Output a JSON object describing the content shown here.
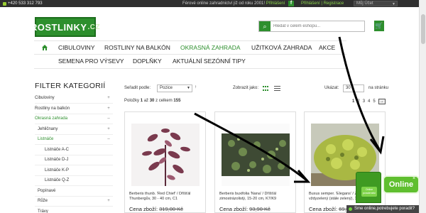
{
  "topbar": {
    "phone": "+420 533 312 793",
    "message": "Férové online zahradnictví již od roku 2001!",
    "message_link": "Přihlášení",
    "register": "Přihlášení | Registrace",
    "account": "Můj Účet"
  },
  "header": {
    "logo_name": "ROSTLINKY",
    "logo_tld": ".CZ",
    "search_placeholder": "Hledat v celém eshopu..."
  },
  "nav": {
    "row1": [
      "CIBULOVINY",
      "ROSTLINY NA BALKÓN",
      "OKRASNÁ ZAHRADA",
      "UŽITKOVÁ ZAHRADA",
      "AKCE"
    ],
    "row2": [
      "SEMENA PRO VÝSEVY",
      "DOPLŇKY",
      "AKTUÁLNÍ SEZÓNNÍ TIPY"
    ],
    "active": "OKRASNÁ ZAHRADA"
  },
  "filter": {
    "title": "FILTER KATEGORIÍ",
    "items": [
      {
        "label": "Cibuloviny",
        "toggle": "+"
      },
      {
        "label": "Rostliny na balkón",
        "toggle": "+"
      },
      {
        "label": "Okrasná zahrada",
        "toggle": "–"
      },
      {
        "label": "Jehličnany",
        "toggle": "+"
      },
      {
        "label": "Listnáče",
        "toggle": "–"
      },
      {
        "label": "Listnáče A-C",
        "toggle": ""
      },
      {
        "label": "Listnáče D-J",
        "toggle": ""
      },
      {
        "label": "Listnáče K-P",
        "toggle": ""
      },
      {
        "label": "Listnáče Q-Z",
        "toggle": ""
      },
      {
        "label": "Popínavé",
        "toggle": ""
      },
      {
        "label": "Růže",
        "toggle": "+"
      },
      {
        "label": "Trávy",
        "toggle": ""
      }
    ]
  },
  "toolbar": {
    "sort_label": "Seřadit podle:",
    "sort_value": "Pozice",
    "sort_dir": "↑",
    "view_label": "Zobrazit jako:",
    "show_label": "Ukázat:",
    "show_value": "30",
    "per_page": "na stránku"
  },
  "listing": {
    "counts_prefix": "Položky",
    "from": "1",
    "to_word": "až",
    "to": "30",
    "of_word": "z celkem",
    "total": "155",
    "pages": [
      "1",
      "2",
      "3",
      "4",
      "5"
    ],
    "next": "→"
  },
  "products": [
    {
      "name": "Berberis thunb. 'Red Chief' / Dříšťál Thunbergův, 30 - 40 cm, C1",
      "price_label": "Cena zboží:",
      "price": "319,00 Kč"
    },
    {
      "name": "Berberis buxifolia 'Nana' / Dříšťál zimostrázolistý, 15-20 cm, K7/K9",
      "price_label": "Cena zboží:",
      "price": "93,90 Kč"
    },
    {
      "name": "Buxus semper. 'Elegans' / Zimostráz vždyzelený (stále zelený), 10-20 cm, K7",
      "price_label": "Cena zboží:",
      "price": "69,90 Kč"
    }
  ],
  "chat": {
    "online": "Online",
    "close": "×",
    "bar": "Sme online,potrebujete poradit?",
    "badge": "Online poradenství"
  },
  "colors": {
    "brand_green": "#2d8f2d",
    "chat_green": "#5fbf2f",
    "topbar": "#2f2f2f"
  }
}
